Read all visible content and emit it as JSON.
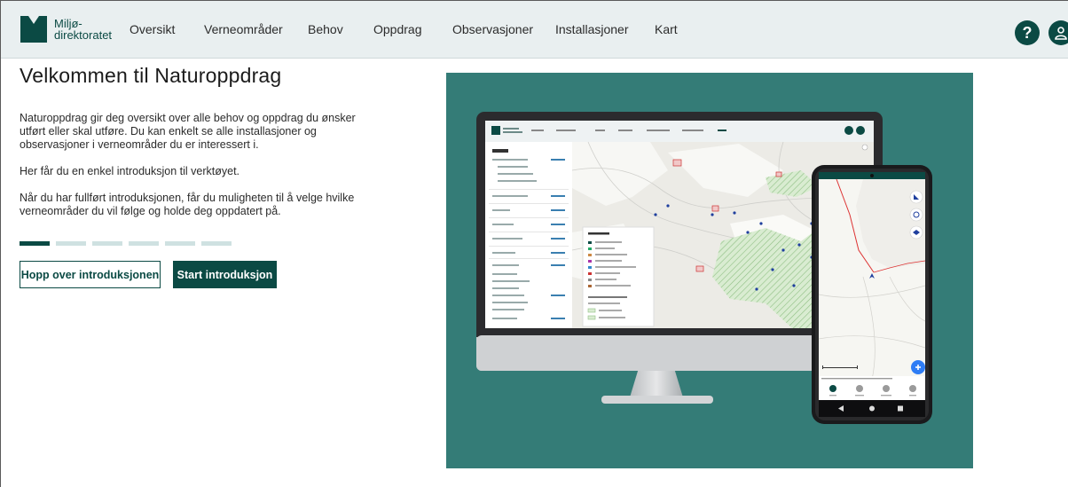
{
  "header": {
    "logo": {
      "line1": "Miljø-",
      "line2": "direktoratet"
    },
    "nav": [
      {
        "label": "Oversikt"
      },
      {
        "label": "Verneområder"
      },
      {
        "label": "Behov"
      },
      {
        "label": "Oppdrag"
      },
      {
        "label": "Observasjoner"
      },
      {
        "label": "Installasjoner"
      },
      {
        "label": "Kart"
      }
    ],
    "help_label": "?"
  },
  "intro": {
    "title": "Velkommen til Naturoppdrag",
    "paragraphs": [
      "Naturoppdrag gir deg oversikt over alle behov og oppdrag du ønsker utført eller skal utføre. Du kan enkelt se alle installasjoner og observasjoner i verneområder du er interessert i.",
      "Her får du en enkel introduksjon til verktøyet.",
      "Når du har fullført introduksjonen, får du muligheten til å velge hvilke verneområder du vil følge og holde deg oppdatert på."
    ],
    "steps_total": 6,
    "step_current": 1,
    "skip_label": "Hopp over introduksjonen",
    "start_label": "Start introduksjon"
  },
  "colors": {
    "brand": "#0b4a44",
    "header_bg": "#e9eff0",
    "illustration_bg": "#347c77",
    "step_inactive": "#cfe1e1"
  }
}
